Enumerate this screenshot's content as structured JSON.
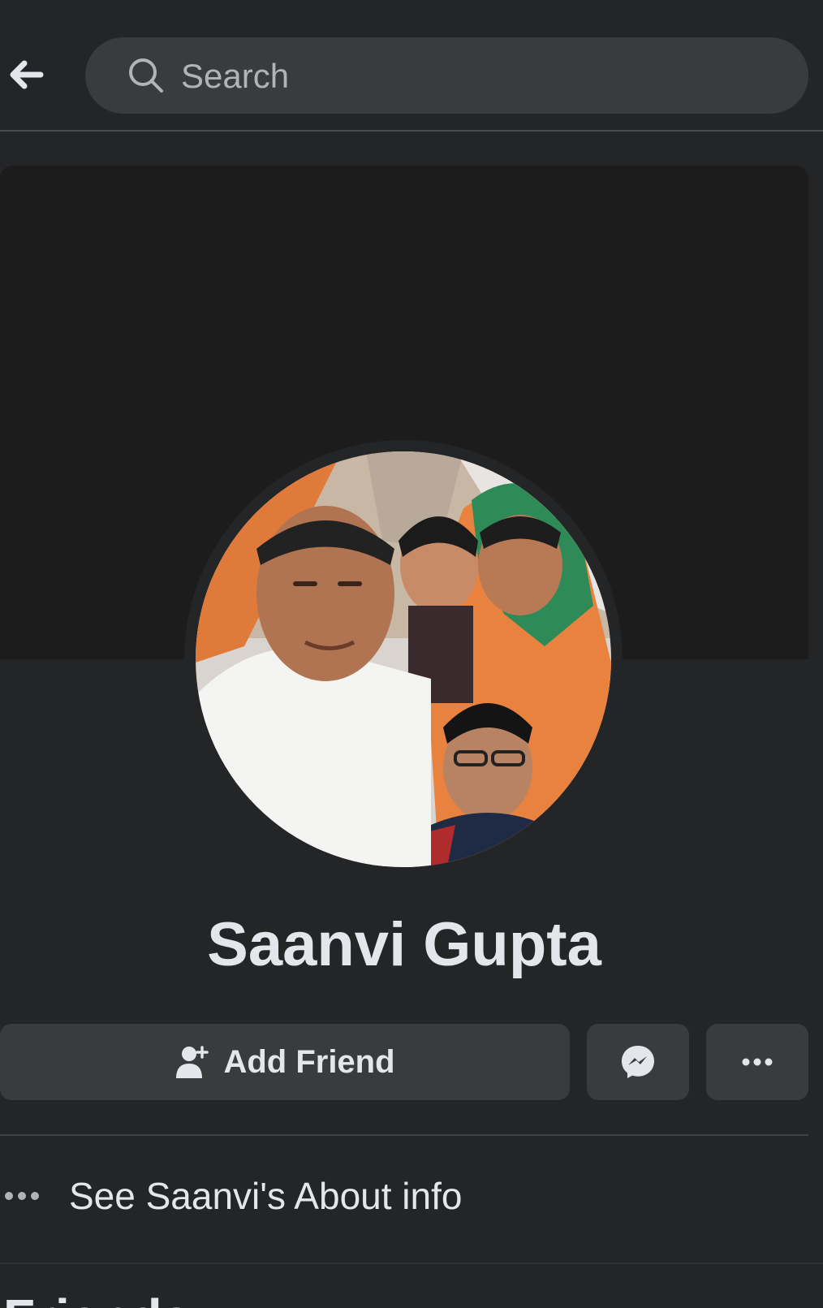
{
  "search": {
    "placeholder": "Search"
  },
  "profile": {
    "name": "Saanvi Gupta"
  },
  "actions": {
    "add_friend_label": "Add Friend"
  },
  "about": {
    "label": "See Saanvi's About info"
  },
  "friends": {
    "heading": "Friends"
  },
  "icons": {
    "back": "arrow-left-icon",
    "search": "search-icon",
    "add_friend": "person-add-icon",
    "messenger": "messenger-icon",
    "more": "more-dots-icon",
    "about": "dots-icon"
  },
  "colors": {
    "background": "#242526",
    "surface": "#3a3b3c",
    "cover": "#1c1c1d",
    "text": "#e4e6eb",
    "secondary_text": "#b0b3b8"
  }
}
